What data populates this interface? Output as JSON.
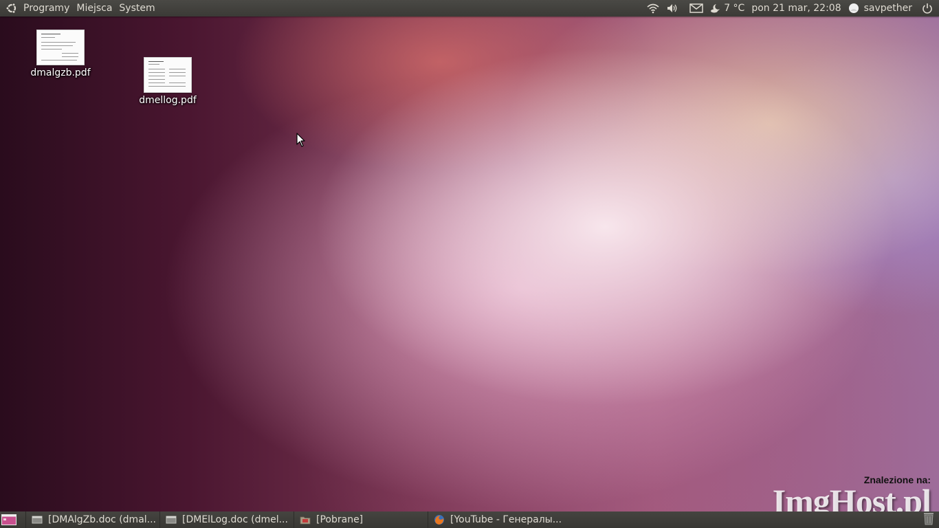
{
  "top_panel": {
    "menus": [
      "Programy",
      "Miejsca",
      "System"
    ],
    "weather": "7 °C",
    "clock": "pon 21 mar, 22:08",
    "user": "savpether"
  },
  "desktop": {
    "icons": [
      {
        "label": "dmalgzb.pdf"
      },
      {
        "label": "dmellog.pdf"
      }
    ]
  },
  "taskbar": {
    "tasks": [
      {
        "label": "[DMAlgZb.doc (dmal..."
      },
      {
        "label": "[DMElLog.doc (dmel..."
      },
      {
        "label": "[Pobrane]"
      },
      {
        "label": "[YouTube - Генералы..."
      }
    ]
  },
  "watermark": {
    "caption": "Znalezione na:",
    "logo": "ImgHost.pl"
  },
  "colors": {
    "panel": "#3b3a36",
    "panel_text": "#dfdbd2"
  }
}
